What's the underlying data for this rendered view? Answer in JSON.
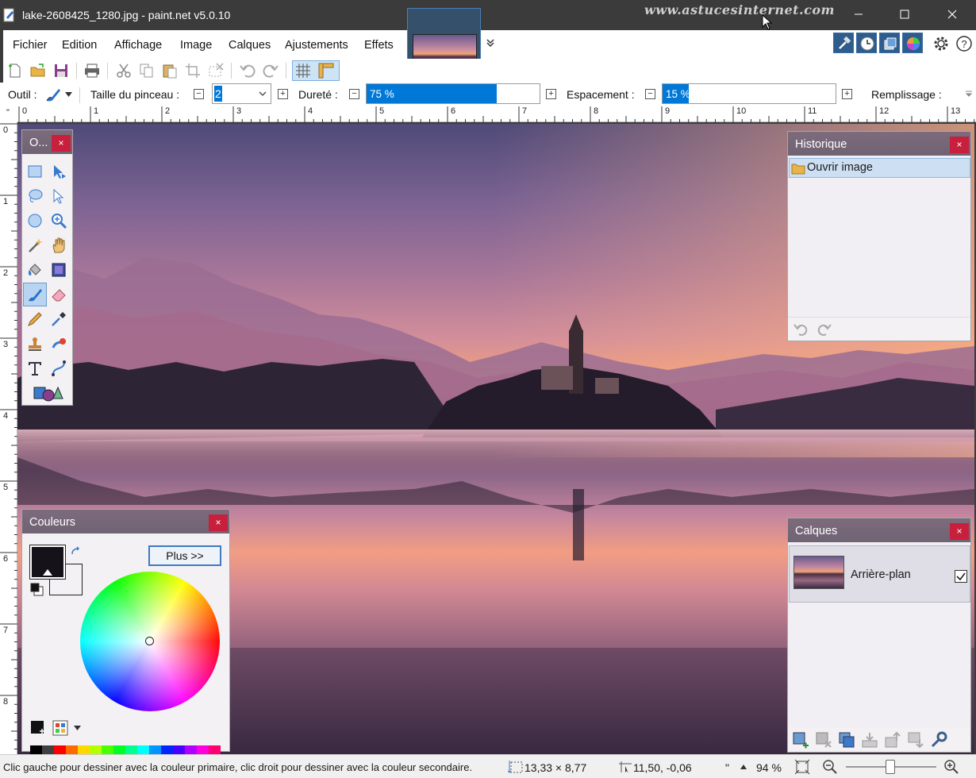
{
  "window": {
    "title": "lake-2608425_1280.jpg - paint.net v5.0.10",
    "watermark": "www.astucesinternet.com"
  },
  "menu": {
    "items": [
      "Fichier",
      "Edition",
      "Affichage",
      "Image",
      "Calques",
      "Ajustements",
      "Effets"
    ]
  },
  "options": {
    "tool_label": "Outil :",
    "brush_size_label": "Taille du pinceau :",
    "brush_size_value": "2",
    "hardness_label": "Dureté :",
    "hardness_value": "75 %",
    "hardness_level": 0.75,
    "spacing_label": "Espacement :",
    "spacing_value": "15 %",
    "spacing_level": 0.15,
    "fill_label": "Remplissage :"
  },
  "rulers": {
    "top": [
      "0",
      "1",
      "2",
      "3",
      "4",
      "5",
      "6",
      "7",
      "8",
      "9",
      "10",
      "11",
      "12",
      "13"
    ],
    "left": [
      "0",
      "1",
      "2",
      "3",
      "4",
      "5",
      "6",
      "7",
      "8"
    ],
    "corner": "\""
  },
  "tools_panel": {
    "title": "O...",
    "close": "×"
  },
  "colors_panel": {
    "title": "Couleurs",
    "close": "×",
    "more_button": "Plus >>",
    "primary_color": "#15121a",
    "secondary_color": "#f3f1f4",
    "palette_row1": [
      "#000000",
      "#404040",
      "#ff0000",
      "#ff6a00",
      "#ffd800",
      "#b6ff00",
      "#4cff00",
      "#00ff21",
      "#00ff90",
      "#00ffff",
      "#0094ff",
      "#0026ff",
      "#4800ff",
      "#b200ff",
      "#ff00dc",
      "#ff006e"
    ],
    "palette_row2": [
      "#ffffff",
      "#808080",
      "#7f0000",
      "#7f3300",
      "#7f6a00",
      "#5b7f00",
      "#267f00",
      "#007f0e",
      "#007f46",
      "#007f7f",
      "#004a7f",
      "#00137f",
      "#21007f",
      "#57007f",
      "#7f006e",
      "#7f0037"
    ]
  },
  "history_panel": {
    "title": "Historique",
    "close": "×",
    "items": [
      "Ouvrir image"
    ]
  },
  "layers_panel": {
    "title": "Calques",
    "close": "×",
    "layers": [
      {
        "name": "Arrière-plan",
        "visible": true
      }
    ]
  },
  "status": {
    "hint": "Clic gauche pour dessiner avec la couleur primaire, clic droit pour dessiner avec la couleur secondaire.",
    "size": "13,33 × 8,77",
    "position": "11,50, -0,06",
    "unit": "\"",
    "zoom": "94 %"
  }
}
